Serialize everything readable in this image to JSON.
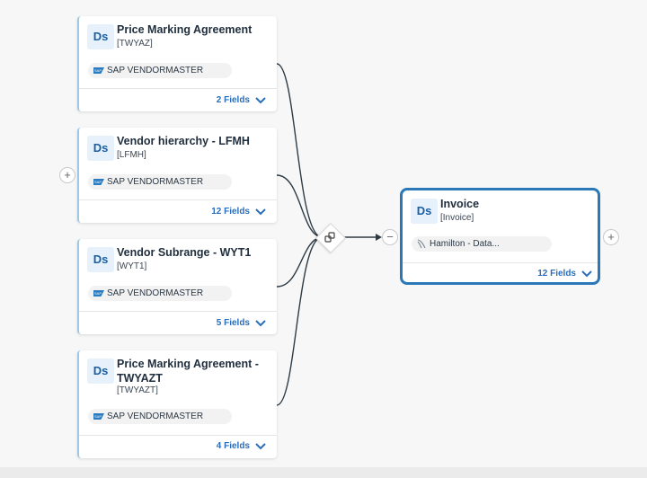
{
  "sources": [
    {
      "title": "Price Marking Agreement",
      "code": "[TWYAZ]",
      "system": "SAP VENDORMASTER",
      "fields": "2 Fields"
    },
    {
      "title": "Vendor hierarchy - LFMH",
      "code": "[LFMH]",
      "system": "SAP VENDORMASTER",
      "fields": "12 Fields"
    },
    {
      "title": "Vendor Subrange - WYT1",
      "code": "[WYT1]",
      "system": "SAP VENDORMASTER",
      "fields": "5 Fields"
    },
    {
      "title": "Price Marking Agreement - TWYAZT",
      "code": "[TWYAZT]",
      "system": "SAP VENDORMASTER",
      "fields": "4 Fields"
    }
  ],
  "target": {
    "title": "Invoice",
    "code": "[Invoice]",
    "system": "Hamilton - Data...",
    "fields": "12 Fields"
  },
  "badge": "Ds",
  "sap_logo_text": "SAP",
  "expand_symbol": "+",
  "collapse_symbol": "−",
  "icons": {
    "join": "join-icon",
    "chevron": "chevron-down-icon",
    "sap": "sap-logo-icon",
    "database": "database-icon"
  },
  "colors": {
    "accent": "#2a78b8",
    "link": "#2a6ebb",
    "badge_bg": "#e6f1fb",
    "edge": "#2e3b45"
  }
}
